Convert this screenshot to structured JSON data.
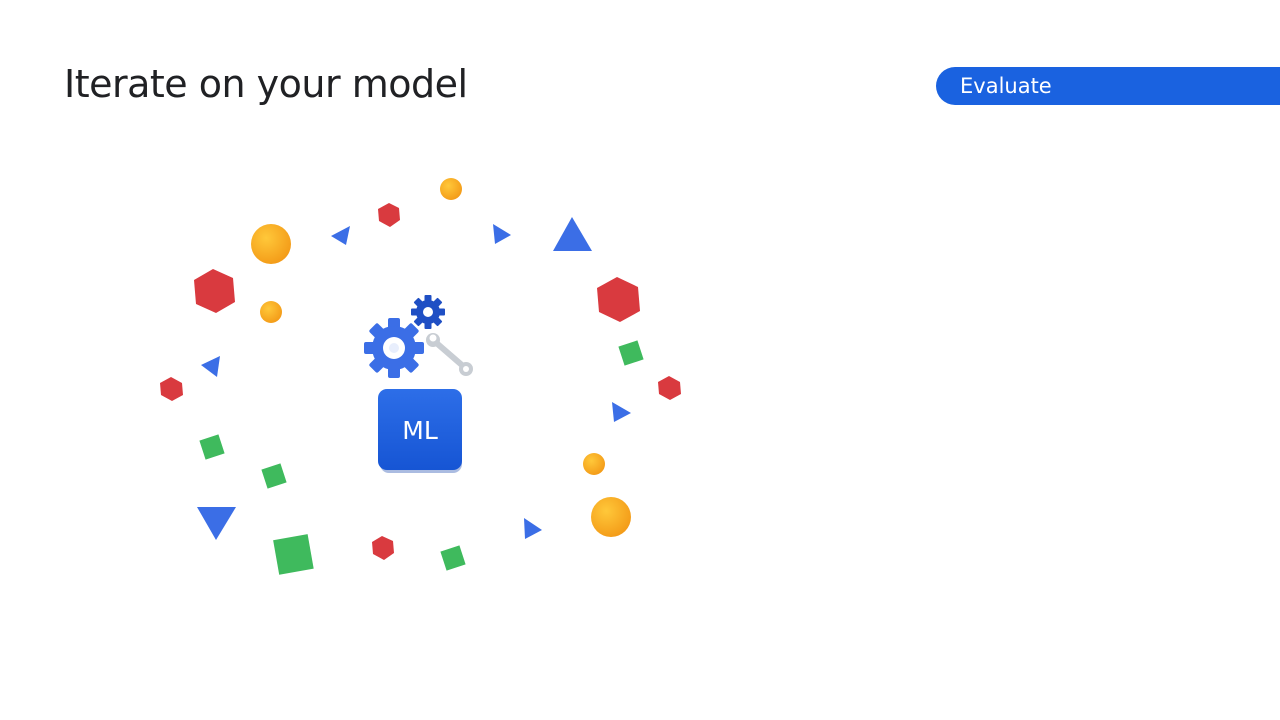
{
  "slide": {
    "title": "Iterate on your model",
    "step_label": "Evaluate"
  },
  "illustration": {
    "model_badge_text": "ML",
    "icons": [
      "gear-icon",
      "wrench-icon"
    ],
    "colors": {
      "blue": "#3b6ee6",
      "dark_blue": "#1f4fc4",
      "red": "#d93a3f",
      "green": "#3fba5d",
      "yellow": "#f5a623",
      "pill_blue": "#1a62e0",
      "wrench_gray": "#c8cdd3"
    }
  }
}
